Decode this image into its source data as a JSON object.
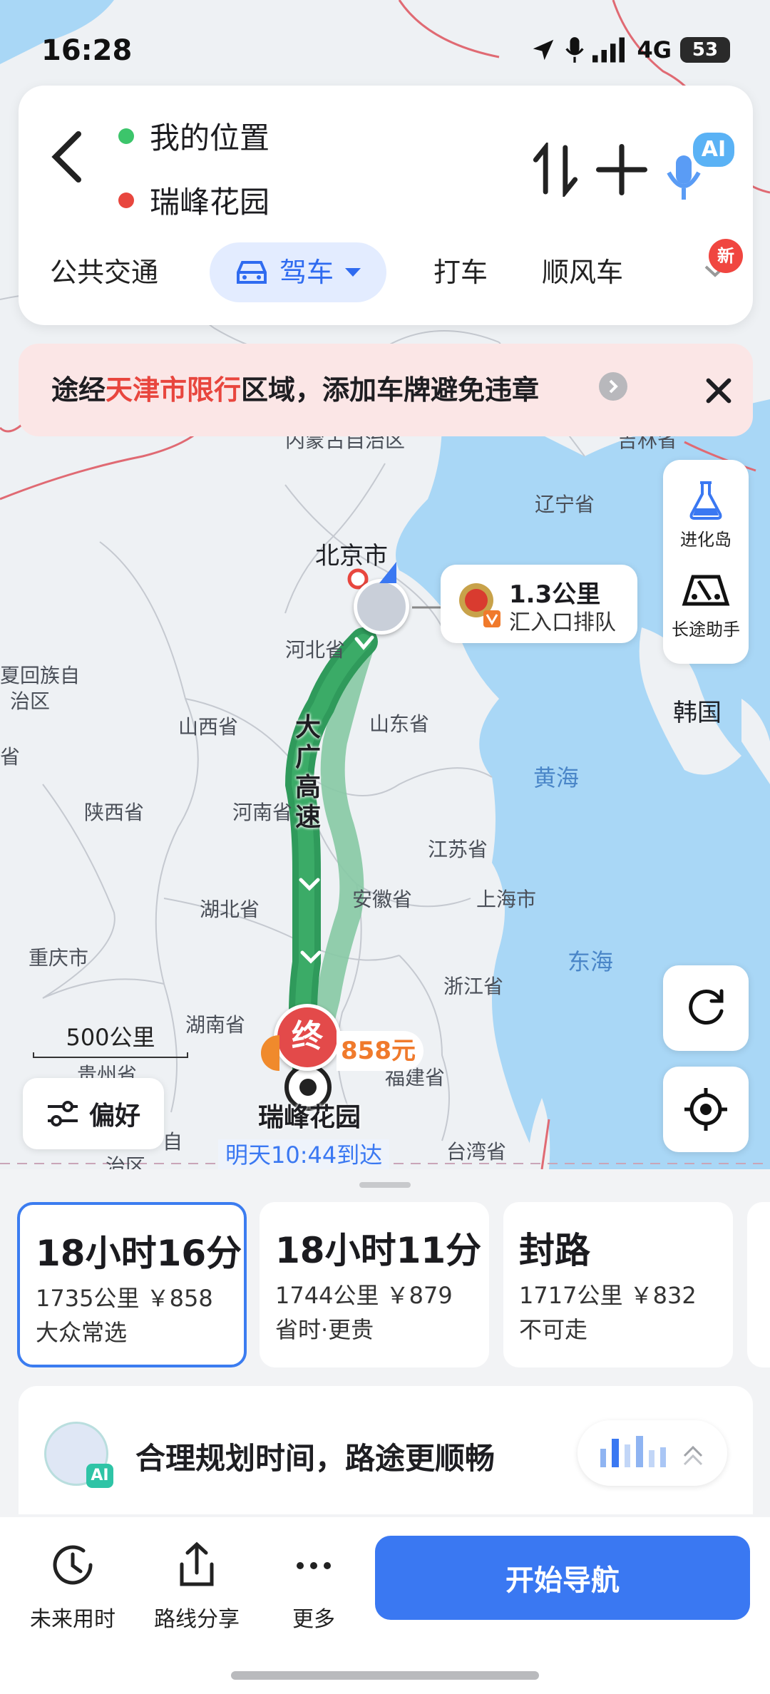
{
  "status_bar": {
    "time": "16:28",
    "network": "4G",
    "battery": "53"
  },
  "route_card": {
    "origin": "我的位置",
    "destination": "瑞峰花园",
    "origin_color": "#3cc56b",
    "destination_color": "#e8463e",
    "ai_badge": "AI",
    "modes": [
      {
        "label": "公共交通"
      },
      {
        "label": "驾车"
      },
      {
        "label": "打车"
      },
      {
        "label": "顺风车"
      }
    ],
    "new_badge": "新"
  },
  "banner": {
    "prefix": "途经",
    "highlight": "天津市限行",
    "suffix": "区域，添加车牌避免违章"
  },
  "map": {
    "labels": {
      "neimenggu": "内蒙古自治区",
      "jilin": "吉林省",
      "liaoning": "辽宁省",
      "beijing": "北京市",
      "hebei": "河北省",
      "ningxia": "夏回族自",
      "ningxia2": "治区",
      "shanxi": "山西省",
      "shandong": "山东省",
      "korea": "韩国",
      "huanghai": "黄海",
      "shaanxi": "陕西省",
      "henan": "河南省",
      "jiangsu": "江苏省",
      "shanghai": "上海市",
      "anhui": "安徽省",
      "hubei": "湖北省",
      "chongqing": "重庆市",
      "donghai": "东海",
      "zhejiang": "浙江省",
      "hunan": "湖南省",
      "guizhou": "贵州省",
      "fujian": "福建省",
      "taiwan": "台湾省",
      "zizhi": "自",
      "zhiqu": "治区",
      "sheng": "省"
    },
    "road_name": "大广高速",
    "destination_label": "瑞峰花园",
    "arrival": "明天10:44到达",
    "end_marker": "终",
    "cost_tag": "858元",
    "scale": "500公里"
  },
  "traffic_bubble": {
    "distance": "1.3公里",
    "desc": "汇入口排队"
  },
  "tools": {
    "lab": "进化岛",
    "long_trip": "长途助手"
  },
  "preference": "偏好",
  "routes": [
    {
      "time": "18小时16分",
      "detail": "1735公里  ￥858",
      "tag": "大众常选"
    },
    {
      "time": "18小时11分",
      "detail": "1744公里  ￥879",
      "tag": "省时·更贵"
    },
    {
      "time": "封路",
      "detail": "1717公里  ￥832",
      "tag": "不可走"
    }
  ],
  "ai_card": {
    "text": "合理规划时间，路途更顺畅",
    "badge": "AI"
  },
  "bottom_bar": {
    "future": "未来用时",
    "share": "路线分享",
    "more": "更多",
    "start": "开始导航"
  }
}
